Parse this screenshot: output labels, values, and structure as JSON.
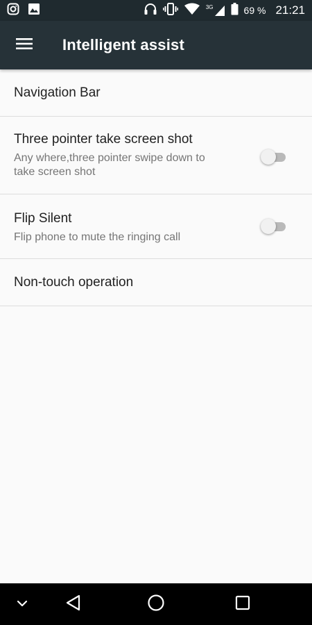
{
  "status_bar": {
    "network": "3G",
    "battery": "69 %",
    "time": "21:21",
    "icons": [
      "instagram-icon",
      "image-icon",
      "headphones-icon",
      "vibrate-icon",
      "wifi-icon",
      "signal-icon",
      "battery-icon"
    ]
  },
  "app_bar": {
    "title": "Intelligent assist",
    "menu_icon": "hamburger-icon"
  },
  "items": [
    {
      "title": "Navigation Bar"
    },
    {
      "title": "Three pointer take screen shot",
      "subtitle": "Any where,three pointer swipe down to take screen shot",
      "toggle": "off"
    },
    {
      "title": "Flip Silent",
      "subtitle": "Flip phone to mute the ringing call",
      "toggle": "off"
    },
    {
      "title": "Non-touch operation"
    }
  ],
  "nav_bar": {
    "icons": [
      "chevron-down-icon",
      "back-icon",
      "home-icon",
      "recents-icon"
    ]
  },
  "colors": {
    "status_bar": "#1f2a2f",
    "app_bar": "#263238",
    "background": "#fafafa",
    "divider": "#dcdcdc"
  }
}
